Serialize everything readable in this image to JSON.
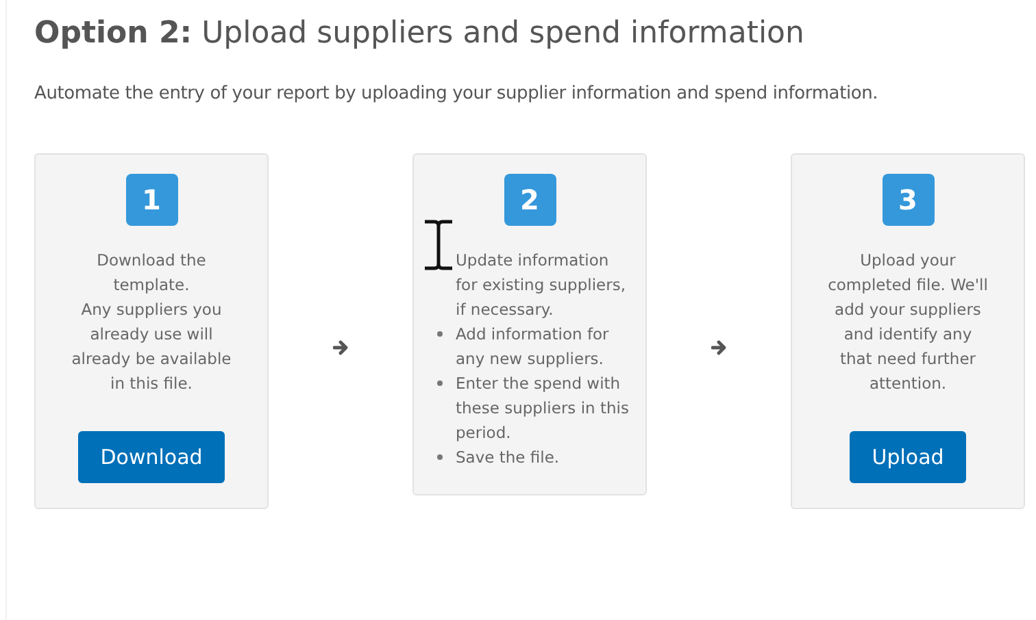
{
  "title": {
    "lead": "Option 2:",
    "text": "Upload suppliers and spend information"
  },
  "intro": "Automate the entry of your report by uploading your supplier information and spend information.",
  "text_cursor": true,
  "steps": [
    {
      "number": "1",
      "kind": "paragraphs",
      "paragraphs": [
        "Download the template.",
        "Any suppliers you already use will already be available in this file."
      ],
      "button": "Download"
    },
    {
      "number": "2",
      "kind": "list",
      "items": [
        "Update information for existing suppliers, if necessary.",
        "Add information for any new suppliers.",
        "Enter the spend with these suppliers in this period.",
        "Save the file."
      ]
    },
    {
      "number": "3",
      "kind": "paragraphs",
      "paragraphs": [
        "Upload your completed file. We'll add your suppliers and identify any that need further attention."
      ],
      "button": "Upload"
    }
  ]
}
